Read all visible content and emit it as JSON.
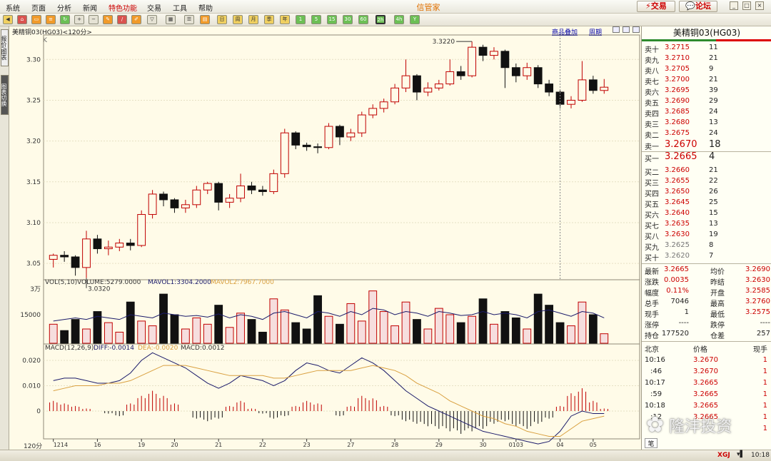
{
  "menu": {
    "items": [
      "系统",
      "页面",
      "分析",
      "新闻",
      "特色功能",
      "交易",
      "工具",
      "帮助"
    ],
    "app_title": "信管家",
    "trade_button": "交易",
    "forum_button": "论坛"
  },
  "toolbar": {
    "icons": [
      "back-icon",
      "home-icon",
      "tv-icon",
      "refresh-icon",
      "zoom-in-icon",
      "zoom-out-icon",
      "pencil-icon",
      "brush-icon",
      "filter-icon",
      "grid-icon",
      "list-icon",
      "calendar-icon",
      "week-icon",
      "month-icon",
      "quarter-icon",
      "year-icon",
      "1min-icon",
      "5min-icon",
      "15min-icon",
      "30min-icon",
      "60min-icon",
      "120min-icon",
      "4hour-icon",
      "yearly-icon"
    ],
    "period_labels": [
      "日",
      "周",
      "月",
      "季",
      "年",
      "1",
      "5",
      "15",
      "30",
      "60",
      "2h",
      "4h",
      "Y"
    ]
  },
  "left_tabs": [
    "报价/图表",
    "图表切换"
  ],
  "chart": {
    "header": "美精铜03(HG03)<120分>",
    "k_label": "K",
    "link_overlay": "商品叠加",
    "link_period": "周期",
    "high_label": "3.3220",
    "low_label": "3.0320",
    "price_ticks": [
      "3.30",
      "3.25",
      "3.20",
      "3.15",
      "3.10",
      "3.05"
    ],
    "vol_header_prefix": "VOL(5,10)",
    "vol_header_volume": "VOLUME:5279.0000",
    "vol_header_mavol1": "MAVOL1:3304.2000",
    "vol_header_mavol2": "MAVOL2:7967.7000",
    "vol_ticks": [
      "3万",
      "15000"
    ],
    "macd_header_prefix": "MACD(12,26,9)",
    "macd_header_diff": "DIFF:-0.0014",
    "macd_header_dea": "DEA:-0.0020",
    "macd_header_macd": "MACD:0.0012",
    "macd_ticks": [
      "0.020",
      "0.010",
      "0"
    ],
    "period_label": "120分",
    "date_labels": [
      "1214",
      "16",
      "19",
      "20",
      "21",
      "22",
      "23",
      "27",
      "28",
      "29",
      "30",
      "0103",
      "04",
      "05"
    ]
  },
  "chart_data": {
    "type": "candlestick",
    "title": "美精铜03(HG03)<120分>",
    "price_range": [
      3.03,
      3.33
    ],
    "candles": [
      [
        3.055,
        3.06,
        3.045,
        3.062
      ],
      [
        3.06,
        3.058,
        3.052,
        3.065
      ],
      [
        3.058,
        3.045,
        3.035,
        3.06
      ],
      [
        3.045,
        3.08,
        3.032,
        3.09
      ],
      [
        3.08,
        3.068,
        3.062,
        3.085
      ],
      [
        3.068,
        3.07,
        3.06,
        3.078
      ],
      [
        3.07,
        3.075,
        3.065,
        3.08
      ],
      [
        3.075,
        3.072,
        3.066,
        3.08
      ],
      [
        3.072,
        3.11,
        3.07,
        3.115
      ],
      [
        3.11,
        3.135,
        3.105,
        3.14
      ],
      [
        3.135,
        3.128,
        3.12,
        3.138
      ],
      [
        3.128,
        3.118,
        3.112,
        3.13
      ],
      [
        3.118,
        3.122,
        3.112,
        3.128
      ],
      [
        3.122,
        3.14,
        3.118,
        3.145
      ],
      [
        3.14,
        3.148,
        3.135,
        3.15
      ],
      [
        3.148,
        3.125,
        3.115,
        3.15
      ],
      [
        3.125,
        3.13,
        3.118,
        3.135
      ],
      [
        3.13,
        3.145,
        3.125,
        3.16
      ],
      [
        3.145,
        3.14,
        3.135,
        3.15
      ],
      [
        3.14,
        3.138,
        3.133,
        3.145
      ],
      [
        3.138,
        3.16,
        3.135,
        3.165
      ],
      [
        3.16,
        3.21,
        3.155,
        3.215
      ],
      [
        3.21,
        3.195,
        3.19,
        3.212
      ],
      [
        3.195,
        3.193,
        3.188,
        3.198
      ],
      [
        3.193,
        3.192,
        3.185,
        3.197
      ],
      [
        3.192,
        3.218,
        3.19,
        3.222
      ],
      [
        3.218,
        3.205,
        3.195,
        3.22
      ],
      [
        3.205,
        3.21,
        3.2,
        3.215
      ],
      [
        3.21,
        3.232,
        3.205,
        3.236
      ],
      [
        3.232,
        3.24,
        3.228,
        3.245
      ],
      [
        3.24,
        3.248,
        3.235,
        3.252
      ],
      [
        3.248,
        3.265,
        3.245,
        3.27
      ],
      [
        3.265,
        3.28,
        3.26,
        3.3
      ],
      [
        3.28,
        3.26,
        3.25,
        3.282
      ],
      [
        3.26,
        3.265,
        3.255,
        3.272
      ],
      [
        3.265,
        3.27,
        3.262,
        3.275
      ],
      [
        3.27,
        3.285,
        3.268,
        3.3
      ],
      [
        3.285,
        3.28,
        3.275,
        3.292
      ],
      [
        3.28,
        3.315,
        3.278,
        3.322
      ],
      [
        3.315,
        3.305,
        3.298,
        3.318
      ],
      [
        3.305,
        3.31,
        3.3,
        3.315
      ],
      [
        3.31,
        3.29,
        3.265,
        3.312
      ],
      [
        3.29,
        3.28,
        3.272,
        3.295
      ],
      [
        3.28,
        3.29,
        3.275,
        3.296
      ],
      [
        3.29,
        3.27,
        3.265,
        3.293
      ],
      [
        3.27,
        3.26,
        3.255,
        3.275
      ],
      [
        3.26,
        3.245,
        3.24,
        3.262
      ],
      [
        3.245,
        3.25,
        3.24,
        3.255
      ],
      [
        3.25,
        3.275,
        3.248,
        3.298
      ],
      [
        3.275,
        3.262,
        3.258,
        3.28
      ],
      [
        3.262,
        3.266,
        3.258,
        3.276
      ]
    ],
    "volume": [
      120,
      80,
      150,
      90,
      200,
      130,
      70,
      260,
      140,
      110,
      310,
      180,
      90,
      160,
      120,
      240,
      100,
      190,
      150,
      70,
      280,
      210,
      130,
      90,
      300,
      170,
      120,
      250,
      140,
      330,
      200,
      110,
      260,
      150,
      90,
      220,
      180,
      130,
      170,
      280,
      120,
      200,
      160,
      90,
      310,
      240,
      130,
      110,
      260,
      180,
      60
    ],
    "mavol1": [
      140,
      150,
      160,
      150,
      170,
      160,
      150,
      180,
      170,
      160,
      190,
      180,
      170,
      175,
      165,
      185,
      160,
      180,
      170,
      150,
      190,
      200,
      180,
      160,
      200,
      190,
      170,
      200,
      180,
      220,
      210,
      180,
      200,
      190,
      170,
      200,
      190,
      175,
      180,
      200,
      180,
      190,
      180,
      160,
      200,
      210,
      190,
      170,
      200,
      190,
      160
    ],
    "macd_hist": [
      0.004,
      0.003,
      0.002,
      0.001,
      0.0,
      -0.001,
      -0.002,
      0.003,
      0.006,
      0.008,
      0.006,
      0.003,
      0.0,
      -0.003,
      -0.004,
      -0.003,
      0.002,
      0.004,
      0.001,
      -0.001,
      -0.003,
      -0.002,
      0.002,
      0.004,
      0.003,
      0.0,
      -0.002,
      0.002,
      0.006,
      0.005,
      0.002,
      -0.002,
      -0.004,
      -0.005,
      -0.006,
      -0.007,
      -0.008,
      -0.009,
      -0.008,
      -0.007,
      -0.005,
      -0.004,
      -0.006,
      -0.007,
      -0.005,
      -0.003,
      0.002,
      0.007,
      0.009,
      0.004,
      0.001
    ],
    "diff": [
      0.012,
      0.013,
      0.013,
      0.012,
      0.011,
      0.011,
      0.012,
      0.015,
      0.02,
      0.023,
      0.021,
      0.019,
      0.017,
      0.014,
      0.011,
      0.009,
      0.011,
      0.014,
      0.013,
      0.012,
      0.01,
      0.012,
      0.016,
      0.019,
      0.018,
      0.016,
      0.015,
      0.018,
      0.021,
      0.019,
      0.016,
      0.012,
      0.008,
      0.005,
      0.002,
      0.0,
      -0.002,
      -0.004,
      -0.006,
      -0.008,
      -0.009,
      -0.01,
      -0.011,
      -0.012,
      -0.013,
      -0.012,
      -0.008,
      -0.002,
      0.0,
      -0.001,
      -0.001
    ],
    "dea": [
      0.008,
      0.009,
      0.01,
      0.01,
      0.01,
      0.011,
      0.011,
      0.012,
      0.014,
      0.016,
      0.018,
      0.018,
      0.018,
      0.017,
      0.016,
      0.015,
      0.014,
      0.014,
      0.014,
      0.014,
      0.013,
      0.013,
      0.014,
      0.015,
      0.016,
      0.016,
      0.016,
      0.016,
      0.017,
      0.018,
      0.017,
      0.016,
      0.014,
      0.011,
      0.009,
      0.007,
      0.004,
      0.002,
      0.0,
      -0.002,
      -0.003,
      -0.005,
      -0.006,
      -0.008,
      -0.009,
      -0.01,
      -0.01,
      -0.007,
      -0.004,
      -0.003,
      -0.002
    ]
  },
  "quote": {
    "title": "美精铜03(HG03)",
    "asks": [
      {
        "label": "卖十",
        "price": "3.2715",
        "vol": "11"
      },
      {
        "label": "卖九",
        "price": "3.2710",
        "vol": "21"
      },
      {
        "label": "卖八",
        "price": "3.2705",
        "vol": "9"
      },
      {
        "label": "卖七",
        "price": "3.2700",
        "vol": "21"
      },
      {
        "label": "卖六",
        "price": "3.2695",
        "vol": "39"
      },
      {
        "label": "卖五",
        "price": "3.2690",
        "vol": "29"
      },
      {
        "label": "卖四",
        "price": "3.2685",
        "vol": "24"
      },
      {
        "label": "卖三",
        "price": "3.2680",
        "vol": "13"
      },
      {
        "label": "卖二",
        "price": "3.2675",
        "vol": "24"
      }
    ],
    "best_ask": {
      "label": "卖一",
      "price": "3.2670",
      "vol": "18"
    },
    "best_bid": {
      "label": "买一",
      "price": "3.2665",
      "vol": "4"
    },
    "bids": [
      {
        "label": "买二",
        "price": "3.2660",
        "vol": "21"
      },
      {
        "label": "买三",
        "price": "3.2655",
        "vol": "22"
      },
      {
        "label": "买四",
        "price": "3.2650",
        "vol": "26"
      },
      {
        "label": "买五",
        "price": "3.2645",
        "vol": "25"
      },
      {
        "label": "买六",
        "price": "3.2640",
        "vol": "15"
      },
      {
        "label": "买七",
        "price": "3.2635",
        "vol": "13"
      },
      {
        "label": "买八",
        "price": "3.2630",
        "vol": "19"
      },
      {
        "label": "买九",
        "price": "3.2625",
        "vol": "8"
      },
      {
        "label": "买十",
        "price": "3.2620",
        "vol": "7"
      }
    ],
    "stats": [
      {
        "l1": "最新",
        "v1": "3.2665",
        "l2": "均价",
        "v2": "3.2690"
      },
      {
        "l1": "涨跌",
        "v1": "0.0035",
        "l2": "昨结",
        "v2": "3.2630"
      },
      {
        "l1": "幅度",
        "v1": "0.11%",
        "l2": "开盘",
        "v2": "3.2585"
      },
      {
        "l1": "总手",
        "v1": "7046",
        "l2": "最高",
        "v2": "3.2760"
      },
      {
        "l1": "现手",
        "v1": "1",
        "l2": "最低",
        "v2": "3.2575"
      },
      {
        "l1": "涨停",
        "v1": "----",
        "l2": "跌停",
        "v2": "----"
      },
      {
        "l1": "持仓",
        "v1": "177520",
        "l2": "仓差",
        "v2": "257"
      }
    ],
    "tick_header": {
      "city": "北京",
      "price": "价格",
      "vol": "现手"
    },
    "ticks": [
      {
        "time": "10:16",
        "price": "3.2670",
        "vol": "1"
      },
      {
        "time": ":46",
        "price": "3.2670",
        "vol": "1"
      },
      {
        "time": "10:17",
        "price": "3.2665",
        "vol": "1"
      },
      {
        "time": ":59",
        "price": "3.2665",
        "vol": "1"
      },
      {
        "time": "10:18",
        "price": "3.2665",
        "vol": "1"
      },
      {
        "time": ":12",
        "price": "3.2665",
        "vol": "1"
      },
      {
        "time": "",
        "price": "",
        "vol": "1"
      }
    ],
    "bottom_tab": "笔"
  },
  "status": {
    "brand": "XGJ",
    "time": "10:18"
  },
  "watermark": "隆沣投资",
  "colors": {
    "up": "#c00000",
    "down": "#111111",
    "diff": "#1a1a6a",
    "dea": "#d9a040",
    "title_green": "#2e8b2e"
  }
}
